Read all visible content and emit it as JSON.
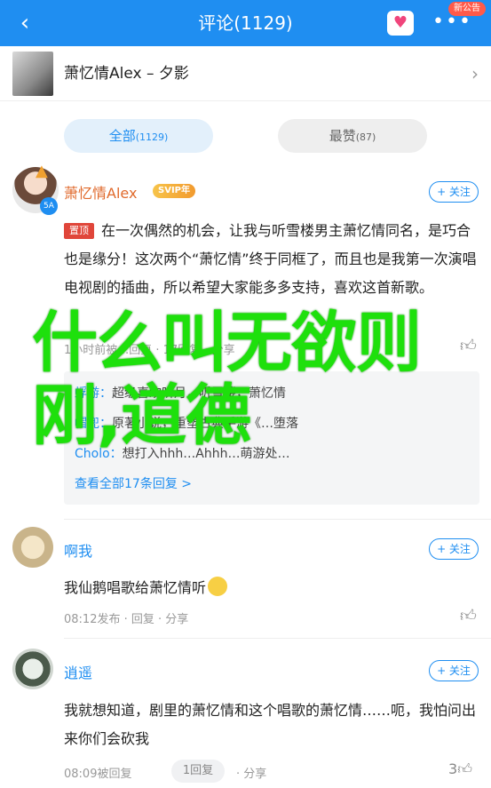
{
  "topbar": {
    "back_glyph": "‹",
    "title": "评论(1129)",
    "badge": "新公告",
    "more_glyph": "•••",
    "heart_icon": "heart-icon"
  },
  "song": {
    "title": "萧忆情Alex – 夕影",
    "chevron": "›"
  },
  "tabs": {
    "all_label": "全部",
    "all_count": "(1129)",
    "top_label": "最赞",
    "top_count": "(87)"
  },
  "comments": [
    {
      "user": "萧忆情Alex",
      "vip": "SVIP年",
      "follow": "+ 关注",
      "pin": "置顶",
      "text": "在一次偶然的机会，让我与听雪楼男主萧忆情同名，是巧合也是缘分！这次两个“萧忆情”终于同框了，而且也是我第一次演唱电视剧的插曲，所以希望大家能多多支持，喜欢这首新歌。",
      "meta": "1小时前被…回复 · 17回复 · 分享",
      "like_count": "",
      "replies": [
        {
          "who": "蜉蝣：",
          "text": "超级喜欢听月，听雪楼，萧忆情"
        },
        {
          "who": "帽兜：",
          "text": "原著小说，重塑古典手游《…堕落"
        },
        {
          "who": "Cholo：",
          "text": "想打入hhh…Ahhh…萌游处…"
        }
      ],
      "view_all": "查看全部17条回复 >"
    },
    {
      "user": "啊我",
      "follow": "+ 关注",
      "text": "我仙鹅唱歌给萧忆情听",
      "meta": "08:12发布 · 回复 · 分享"
    },
    {
      "user": "逍遥",
      "follow": "+ 关注",
      "text": "我就想知道，剧里的萧忆情和这个唱歌的萧忆情……呃，我怕问出来你们会砍我",
      "meta": "08:09被回复",
      "reply_pill": "1回复",
      "share": "· 分享",
      "like_count": "3"
    }
  ],
  "overlay_text": "什么叫无欲则刚,道德",
  "colors": {
    "brand_blue": "#1f8ef1",
    "overlay_green": "#1ee00c",
    "pin_red": "#e0463a"
  }
}
